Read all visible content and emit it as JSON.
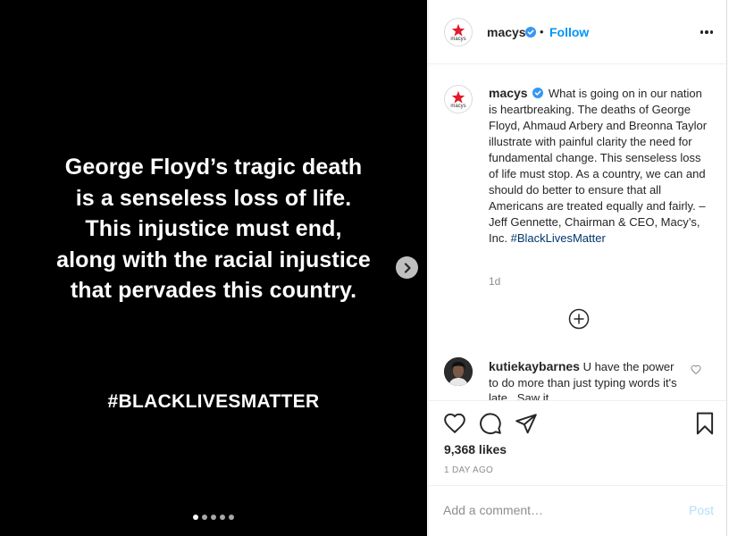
{
  "media": {
    "lines": [
      "George Floyd’s tragic death",
      "is a senseless loss of life.",
      "This injustice must end,",
      "along with the racial injustice",
      "that pervades this country."
    ],
    "hashtag": "#BLACKLIVESMATTER",
    "carousel": {
      "count": 5,
      "active_index": 0
    }
  },
  "header": {
    "username": "macys",
    "separator": "•",
    "follow_label": "Follow",
    "logo_text": "macys",
    "icons": {
      "verified": "verified-badge-icon",
      "more": "more-options-icon"
    }
  },
  "caption": {
    "username": "macys",
    "text": "What is going on in our nation is heartbreaking. The deaths of George Floyd, Ahmaud Arbery and Breonna Taylor illustrate with painful clarity the need for fundamental change. This senseless loss of life must stop. As a country, we can and should do better to ensure that all Americans are treated equally and fairly. – Jeff Gennette, Chairman & CEO, Macy’s, Inc.",
    "hashtag": "#BlackLivesMatter",
    "time_ago": "1d"
  },
  "comment": {
    "username": "kutiekaybarnes",
    "text": "U have the power to do more than just typing words it's late . Saw it"
  },
  "actions": {
    "likes": "9,368 likes",
    "date": "1 DAY AGO",
    "icons": [
      "heart-icon",
      "comment-icon",
      "share-icon",
      "bookmark-icon"
    ]
  },
  "add_comment": {
    "placeholder": "Add a comment…",
    "post_label": "Post"
  },
  "colors": {
    "brand_red": "#e21a2c",
    "link_blue": "#0095f6",
    "verified_blue": "#3897f0",
    "post_disabled": "#b2dffc"
  }
}
